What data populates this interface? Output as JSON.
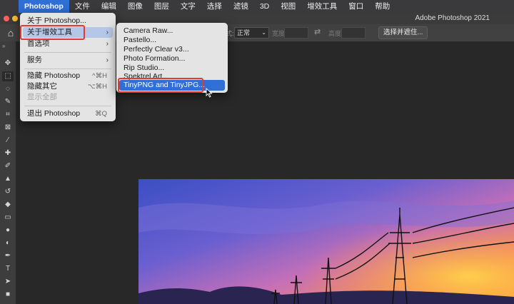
{
  "menubar": {
    "items": [
      "Photoshop",
      "文件",
      "编辑",
      "图像",
      "图层",
      "文字",
      "选择",
      "滤镜",
      "3D",
      "视图",
      "增效工具",
      "窗口",
      "帮助"
    ]
  },
  "window": {
    "title": "Adobe Photoshop 2021"
  },
  "options": {
    "style_label": "式:",
    "style_value": "正常",
    "width_label": "宽度:",
    "height_label": "高度:",
    "select_mask": "选择并遮住..."
  },
  "photoshop_menu": {
    "items": [
      {
        "label": "关于 Photoshop...",
        "shortcut": ""
      },
      {
        "label": "关于增效工具",
        "shortcut": "",
        "submenu": true
      },
      {
        "label": "首选项",
        "shortcut": "",
        "submenu": true
      },
      {
        "label": "服务",
        "shortcut": "",
        "submenu": true
      },
      {
        "label": "隐藏 Photoshop",
        "shortcut": "^⌘H"
      },
      {
        "label": "隐藏其它",
        "shortcut": "⌥⌘H"
      },
      {
        "label": "显示全部",
        "shortcut": "",
        "disabled": true
      },
      {
        "label": "退出 Photoshop",
        "shortcut": "⌘Q"
      }
    ]
  },
  "plugins_submenu": {
    "items": [
      "Camera Raw...",
      "Pastello...",
      "Perfectly Clear v3...",
      "Photo Formation...",
      "Rip Studio...",
      "Spektrel Art...",
      "TinyPNG and TinyJPG..."
    ]
  },
  "tools": [
    "move-icon",
    "marquee-icon",
    "lasso-icon",
    "quick-select-icon",
    "crop-icon",
    "frame-icon",
    "eyedropper-icon",
    "healing-icon",
    "brush-icon",
    "stamp-icon",
    "history-brush-icon",
    "eraser-icon",
    "gradient-icon",
    "blur-icon",
    "dodge-icon",
    "pen-icon",
    "type-icon",
    "path-select-icon",
    "rectangle-icon"
  ],
  "colors": {
    "accent": "#2f6fd6",
    "highlight_box": "#e8392e"
  }
}
